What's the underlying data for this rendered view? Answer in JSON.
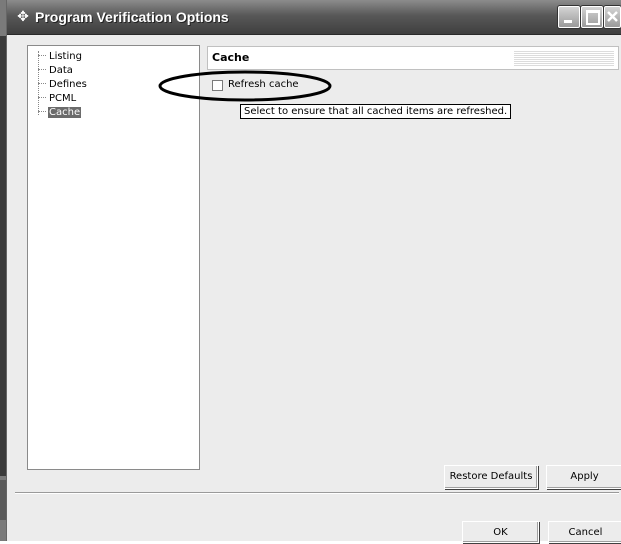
{
  "window": {
    "title": "Program Verification Options",
    "icon": "crosshair-icon"
  },
  "titlebar_buttons": {
    "minimize": "minimize-icon",
    "maximize": "maximize-icon",
    "close": "close-icon"
  },
  "tree": {
    "items": [
      {
        "label": "Listing",
        "selected": false
      },
      {
        "label": "Data",
        "selected": false
      },
      {
        "label": "Defines",
        "selected": false
      },
      {
        "label": "PCML",
        "selected": false
      },
      {
        "label": "Cache",
        "selected": true
      }
    ]
  },
  "page": {
    "header": "Cache",
    "checkbox": {
      "label": "Refresh cache",
      "checked": false
    },
    "tooltip": "Select to ensure that all cached items are refreshed."
  },
  "buttons": {
    "restore_defaults": "Restore Defaults",
    "apply": "Apply",
    "ok": "OK",
    "cancel": "Cancel"
  },
  "colors": {
    "selection": "#6b6b6b",
    "annotation": "#000000"
  }
}
